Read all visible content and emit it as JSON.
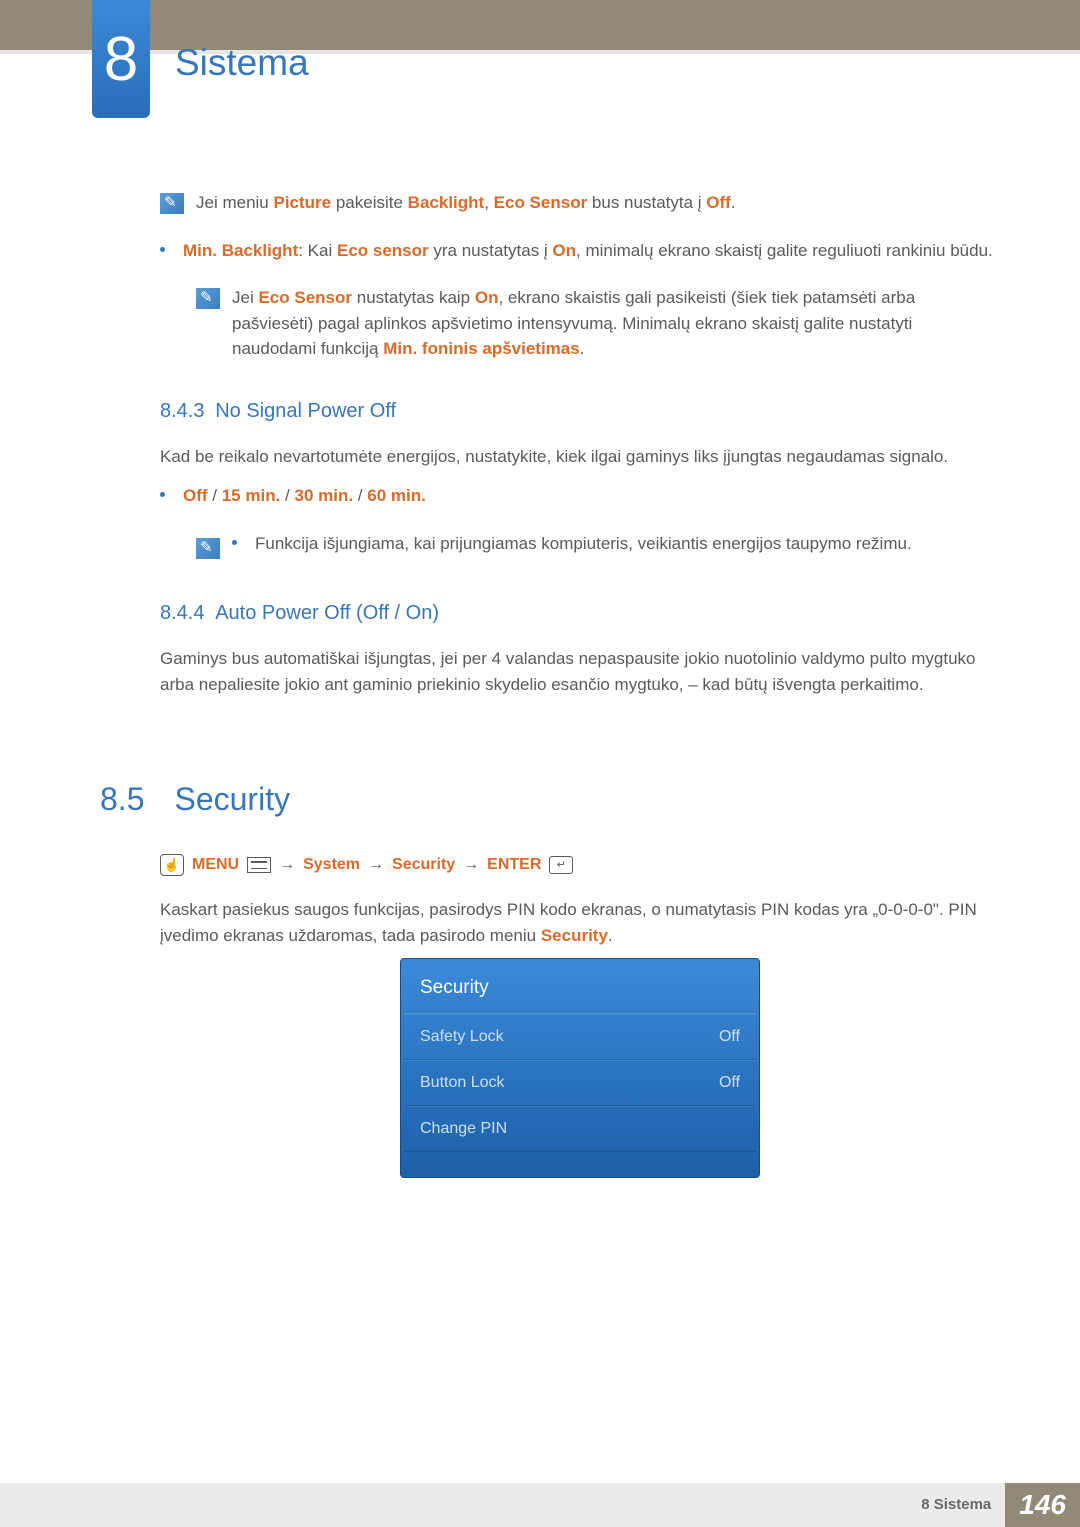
{
  "chapter": {
    "number": "8",
    "title": "Sistema"
  },
  "note1": {
    "prefix": "Jei meniu ",
    "w1": "Picture",
    "mid1": " pakeisite ",
    "w2": "Backlight",
    "mid2": ", ",
    "w3": "Eco Sensor",
    "mid3": " bus nustatyta į ",
    "w4": "Off",
    "suffix": "."
  },
  "bullet1": {
    "b1": "Min. Backlight",
    "t1": ": Kai ",
    "b2": "Eco sensor",
    "t2": " yra nustatytas į ",
    "b3": "On",
    "t3": ", minimalų ekrano skaistį galite reguliuoti rankiniu būdu."
  },
  "note2": {
    "t1": "Jei ",
    "b1": "Eco Sensor",
    "t2": " nustatytas kaip ",
    "b2": "On",
    "t3": ", ekrano skaistis gali pasikeisti (šiek tiek patamsėti arba pašviesėti) pagal aplinkos apšvietimo intensyvumą. Minimalų ekrano skaistį galite nustatyti naudodami funkciją ",
    "b3": "Min. foninis apšvietimas",
    "t4": "."
  },
  "s843": {
    "num": "8.4.3",
    "title": "No Signal Power Off",
    "desc": "Kad be reikalo nevartotumėte energijos, nustatykite, kiek ilgai gaminys liks įjungtas negaudamas signalo.",
    "opt_off": "Off",
    "sep": " / ",
    "opt_15": "15 min.",
    "opt_30": "30 min.",
    "opt_60": "60 min.",
    "note": "Funkcija išjungiama, kai prijungiamas kompiuteris, veikiantis energijos taupymo režimu."
  },
  "s844": {
    "num": "8.4.4",
    "title": "Auto Power Off (Off / On)",
    "desc": "Gaminys bus automatiškai išjungtas, jei per 4 valandas nepaspausite jokio nuotolinio valdymo pulto mygtuko arba nepaliesite jokio ant gaminio priekinio skydelio esančio mygtuko, – kad būtų išvengta perkaitimo."
  },
  "s85": {
    "num": "8.5",
    "title": "Security",
    "menu_label": "MENU",
    "path": {
      "p1": "System",
      "p2": "Security",
      "p3": "ENTER"
    },
    "arrow": "→",
    "desc1": "Kaskart pasiekus saugos funkcijas, pasirodys PIN kodo ekranas, o numatytasis PIN kodas yra „0-0-0-0\". PIN įvedimo ekranas uždaromas, tada pasirodo meniu ",
    "desc1b": "Security",
    "desc1c": "."
  },
  "panel": {
    "header": "Security",
    "rows": [
      {
        "label": "Safety Lock",
        "value": "Off"
      },
      {
        "label": "Button Lock",
        "value": "Off"
      },
      {
        "label": "Change PIN",
        "value": ""
      }
    ]
  },
  "footer": {
    "label": "8 Sistema",
    "page": "146"
  }
}
